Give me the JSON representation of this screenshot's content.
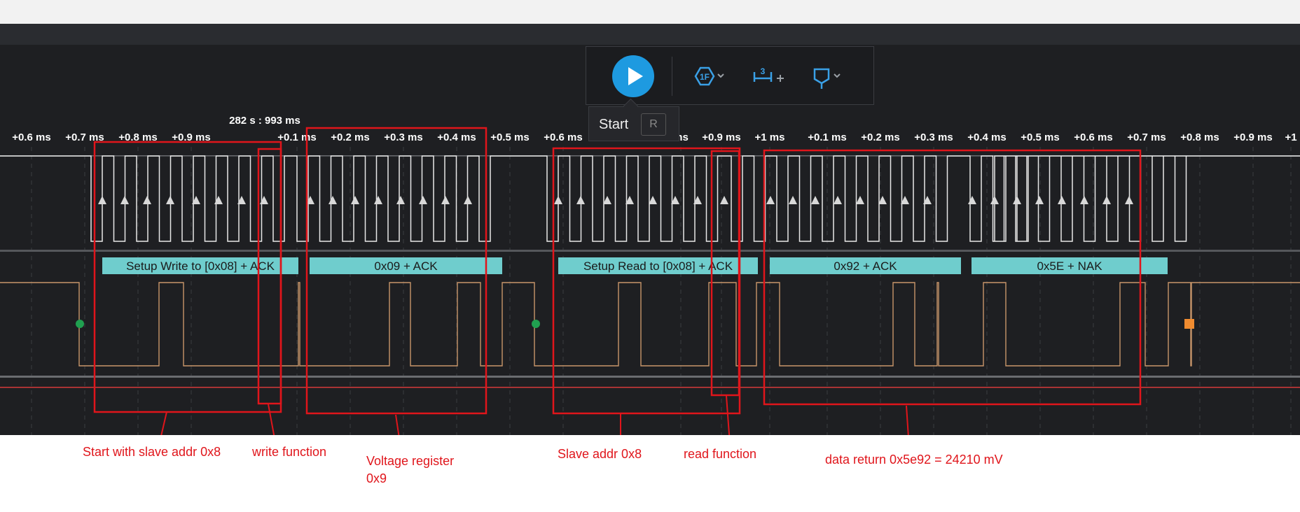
{
  "timestamp": "282 s : 993 ms",
  "time_ticks": [
    "+0.6 ms",
    "+0.7 ms",
    "+0.8 ms",
    "+0.9 ms",
    "+0.1 ms",
    "+0.2 ms",
    "+0.3 ms",
    "+0.4 ms",
    "+0.5 ms",
    "+0.6 ms",
    "ms",
    "+0.9 ms",
    "+1 ms",
    "+0.1 ms",
    "+0.2 ms",
    "+0.3 ms",
    "+0.4 ms",
    "+0.5 ms",
    "+0.6 ms",
    "+0.7 ms",
    "+0.8 ms",
    "+0.9 ms",
    "+1"
  ],
  "decoded_frames": [
    "Setup Write to [0x08] + ACK",
    "0x09 + ACK",
    "Setup Read to [0x08] + ACK",
    "0x92 + ACK",
    "0x5E + NAK"
  ],
  "tooltip": {
    "label": "Start",
    "shortcut": "R"
  },
  "toolbar": {
    "trigger_icon_text": "1F",
    "measure_icon_text": "3",
    "icons": [
      "play-icon",
      "trigger-icon",
      "measure-icon",
      "marker-icon"
    ]
  },
  "annotations": {
    "start_slave": "Start with  slave addr 0x8",
    "write_function": "write function",
    "voltage_register_line1": "Voltage register",
    "voltage_register_line2": "0x9",
    "slave_addr": "Slave addr 0x8",
    "read_function": "read function",
    "data_return": "data return 0x5e92 = 24210 mV"
  },
  "colors": {
    "background": "#1e1f22",
    "clock_signal": "#e8e8e8",
    "data_signal": "#c8966a",
    "decoder_bar": "#6fcdcd",
    "accent": "#1e9ae0",
    "annotation": "#e0151b",
    "start_marker": "#20a050",
    "stop_marker": "#f08c30"
  }
}
